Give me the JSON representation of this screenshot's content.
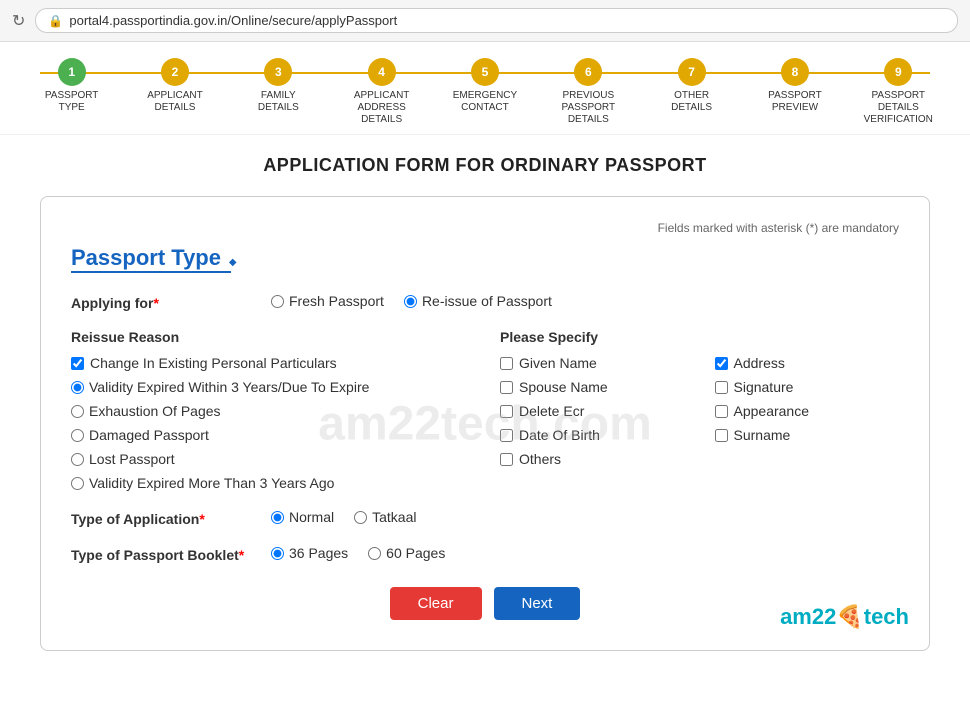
{
  "browser": {
    "url": "portal4.passportindia.gov.in/Online/secure/applyPassport",
    "refresh_icon": "↻"
  },
  "steps": [
    {
      "number": "1",
      "label": "PASSPORT TYPE",
      "state": "completed"
    },
    {
      "number": "2",
      "label": "APPLICANT DETAILS",
      "state": "active"
    },
    {
      "number": "3",
      "label": "FAMILY DETAILS",
      "state": "pending"
    },
    {
      "number": "4",
      "label": "APPLICANT ADDRESS DETAILS",
      "state": "pending"
    },
    {
      "number": "5",
      "label": "EMERGENCY CONTACT",
      "state": "pending"
    },
    {
      "number": "6",
      "label": "PREVIOUS PASSPORT DETAILS",
      "state": "pending"
    },
    {
      "number": "7",
      "label": "OTHER DETAILS",
      "state": "pending"
    },
    {
      "number": "8",
      "label": "PASSPORT PREVIEW",
      "state": "pending"
    },
    {
      "number": "9",
      "label": "PASSPORT DETAILS VERIFICATION",
      "state": "pending"
    }
  ],
  "page_title": "APPLICATION FORM FOR ORDINARY PASSPORT",
  "mandatory_note": "Fields marked with asterisk (*) are mandatory",
  "section_title": "Passport Type",
  "applying_for": {
    "label": "Applying for",
    "required": true,
    "options": [
      {
        "value": "fresh",
        "label": "Fresh Passport",
        "checked": false
      },
      {
        "value": "reissue",
        "label": "Re-issue of Passport",
        "checked": true
      }
    ]
  },
  "reissue_reason": {
    "title": "Reissue Reason",
    "options": [
      {
        "value": "change_personal",
        "label": "Change In Existing Personal Particulars",
        "checked": true,
        "type": "checkbox"
      },
      {
        "value": "validity_expired_3",
        "label": "Validity Expired Within 3 Years/Due To Expire",
        "checked": true,
        "type": "radio"
      },
      {
        "value": "exhaustion",
        "label": "Exhaustion Of Pages",
        "checked": false,
        "type": "radio"
      },
      {
        "value": "damaged",
        "label": "Damaged Passport",
        "checked": false,
        "type": "radio"
      },
      {
        "value": "lost",
        "label": "Lost Passport",
        "checked": false,
        "type": "radio"
      },
      {
        "value": "validity_expired_more",
        "label": "Validity Expired More Than 3 Years Ago",
        "checked": false,
        "type": "radio"
      }
    ]
  },
  "please_specify": {
    "title": "Please Specify",
    "options": [
      {
        "value": "given_name",
        "label": "Given Name",
        "checked": false
      },
      {
        "value": "address",
        "label": "Address",
        "checked": true
      },
      {
        "value": "spouse_name",
        "label": "Spouse Name",
        "checked": false
      },
      {
        "value": "signature",
        "label": "Signature",
        "checked": false
      },
      {
        "value": "delete_ecr",
        "label": "Delete Ecr",
        "checked": false
      },
      {
        "value": "appearance",
        "label": "Appearance",
        "checked": false
      },
      {
        "value": "date_of_birth",
        "label": "Date Of Birth",
        "checked": false
      },
      {
        "value": "surname",
        "label": "Surname",
        "checked": false
      },
      {
        "value": "others",
        "label": "Others",
        "checked": false
      }
    ]
  },
  "type_of_application": {
    "label": "Type of Application",
    "required": true,
    "options": [
      {
        "value": "normal",
        "label": "Normal",
        "checked": true
      },
      {
        "value": "tatkaal",
        "label": "Tatkaal",
        "checked": false
      }
    ]
  },
  "type_of_passport_booklet": {
    "label": "Type of Passport Booklet",
    "required": true,
    "options": [
      {
        "value": "36",
        "label": "36 Pages",
        "checked": true
      },
      {
        "value": "60",
        "label": "60 Pages",
        "checked": false
      }
    ]
  },
  "buttons": {
    "clear": "Clear",
    "next": "Next"
  },
  "watermark": "am22tech.com",
  "branding": {
    "prefix": "am22",
    "suffix": "tech"
  }
}
